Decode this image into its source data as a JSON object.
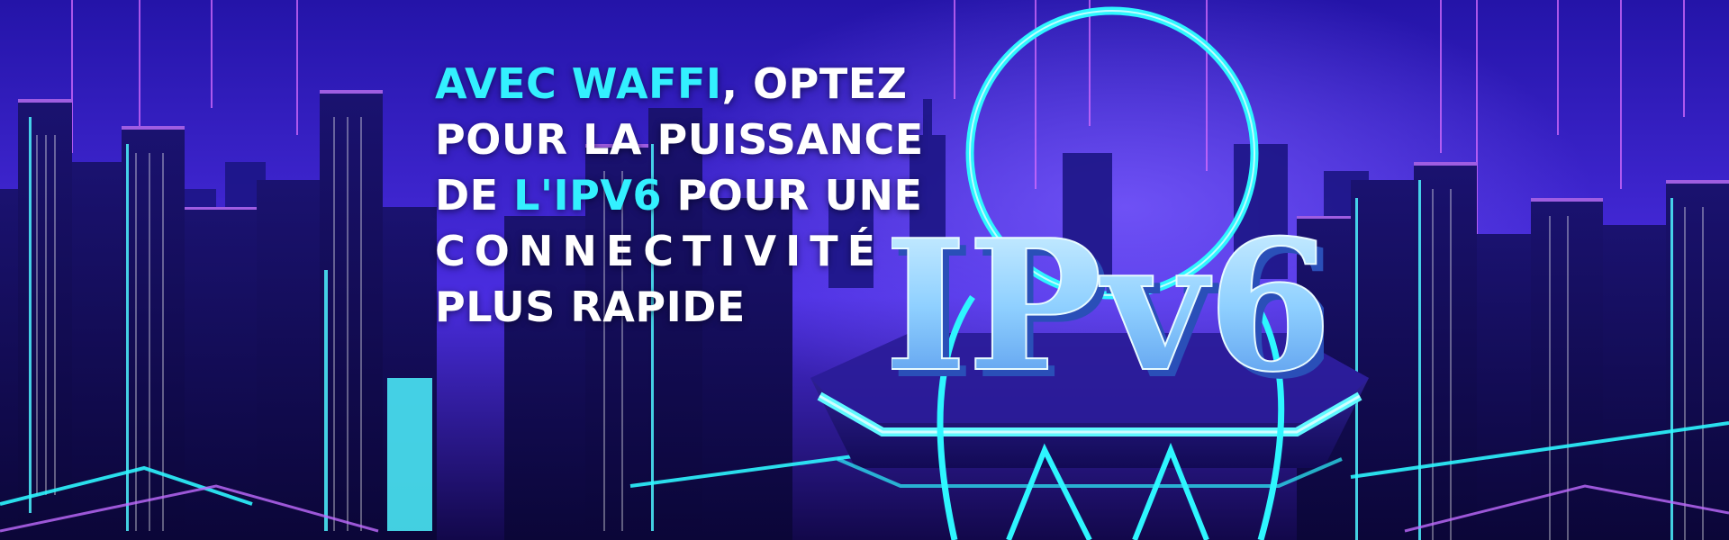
{
  "banner": {
    "headline": {
      "line1_highlight": "AVEC WAFFI",
      "line1_rest": ", OPTEZ",
      "line2": "POUR LA PUISSANCE",
      "line3_start": "DE ",
      "line3_highlight": "L'IPV6",
      "line3_rest": " POUR UNE",
      "line4": "CONNECTIVITÉ",
      "line5": "PLUS RAPIDE"
    },
    "logo_text": "IPv6",
    "colors": {
      "highlight": "#33f0ff",
      "text": "#ffffff",
      "background": "#2a1aa8",
      "neon_cyan": "#2ef6ff",
      "neon_purple": "#c06bff"
    }
  }
}
